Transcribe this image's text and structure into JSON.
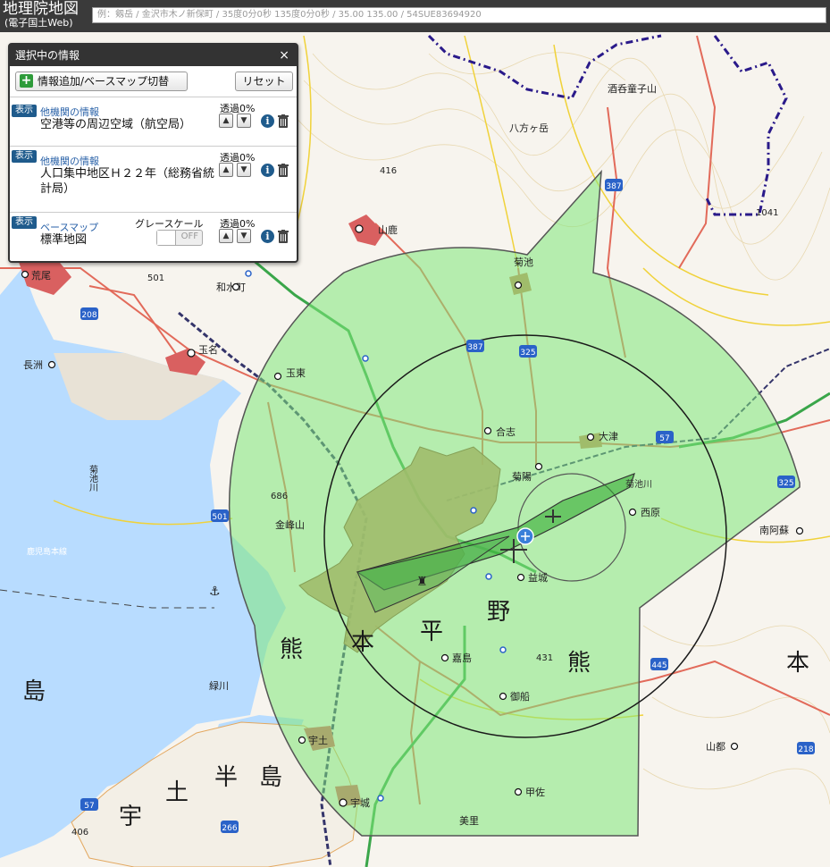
{
  "app": {
    "title_line1": "地理院地図",
    "title_line2": "(電子国土Web)"
  },
  "search": {
    "placeholder": "例：剱岳 / 金沢市木ノ新保町 / 35度0分0秒 135度0分0秒 / 35.00 135.00 / 54SUE83694920"
  },
  "panel": {
    "title": "選択中の情報",
    "close": "×",
    "add_button": "情報追加/ベースマップ切替",
    "reset_button": "リセット",
    "layers": [
      {
        "badge": "表示",
        "category": "他機関の情報",
        "title": "空港等の周辺空域（航空局）",
        "transparency": "透過0%"
      },
      {
        "badge": "表示",
        "category": "他機関の情報",
        "title": "人口集中地区Ｈ２２年（総務省統計局）",
        "transparency": "透過0%"
      },
      {
        "badge": "表示",
        "category": "ベースマップ",
        "title": "標準地図",
        "transparency": "透過0%",
        "grayscale_label": "グレースケール",
        "grayscale_state": "OFF"
      }
    ]
  },
  "map": {
    "place_labels": [
      "酒呑童子山",
      "八方ヶ岳",
      "山鹿",
      "和水町",
      "荒尾",
      "玉名",
      "長洲",
      "玉東",
      "菊池",
      "合志",
      "大津",
      "菊陽",
      "西原",
      "益城",
      "嘉島",
      "御船",
      "甲佐",
      "美里",
      "宇土",
      "宇城",
      "南阿蘇",
      "山都",
      "金峰山",
      "緑川",
      "菊池川",
      "鹿児島本線",
      "菊池川"
    ],
    "large_labels": [
      "熊",
      "本",
      "平",
      "野",
      "熊",
      "本",
      "島",
      "宇",
      "土",
      "半",
      "島"
    ],
    "elevations": [
      "416",
      "501",
      "686",
      "431",
      "406",
      "1041"
    ],
    "route_numbers": [
      "387",
      "208",
      "387",
      "325",
      "57",
      "325",
      "501",
      "445",
      "218",
      "57",
      "266"
    ],
    "colors": {
      "airspace": "#7fe87a",
      "dense_area": "#c8885a",
      "sea": "#b8dcff",
      "border": "#2a1a8a"
    }
  }
}
